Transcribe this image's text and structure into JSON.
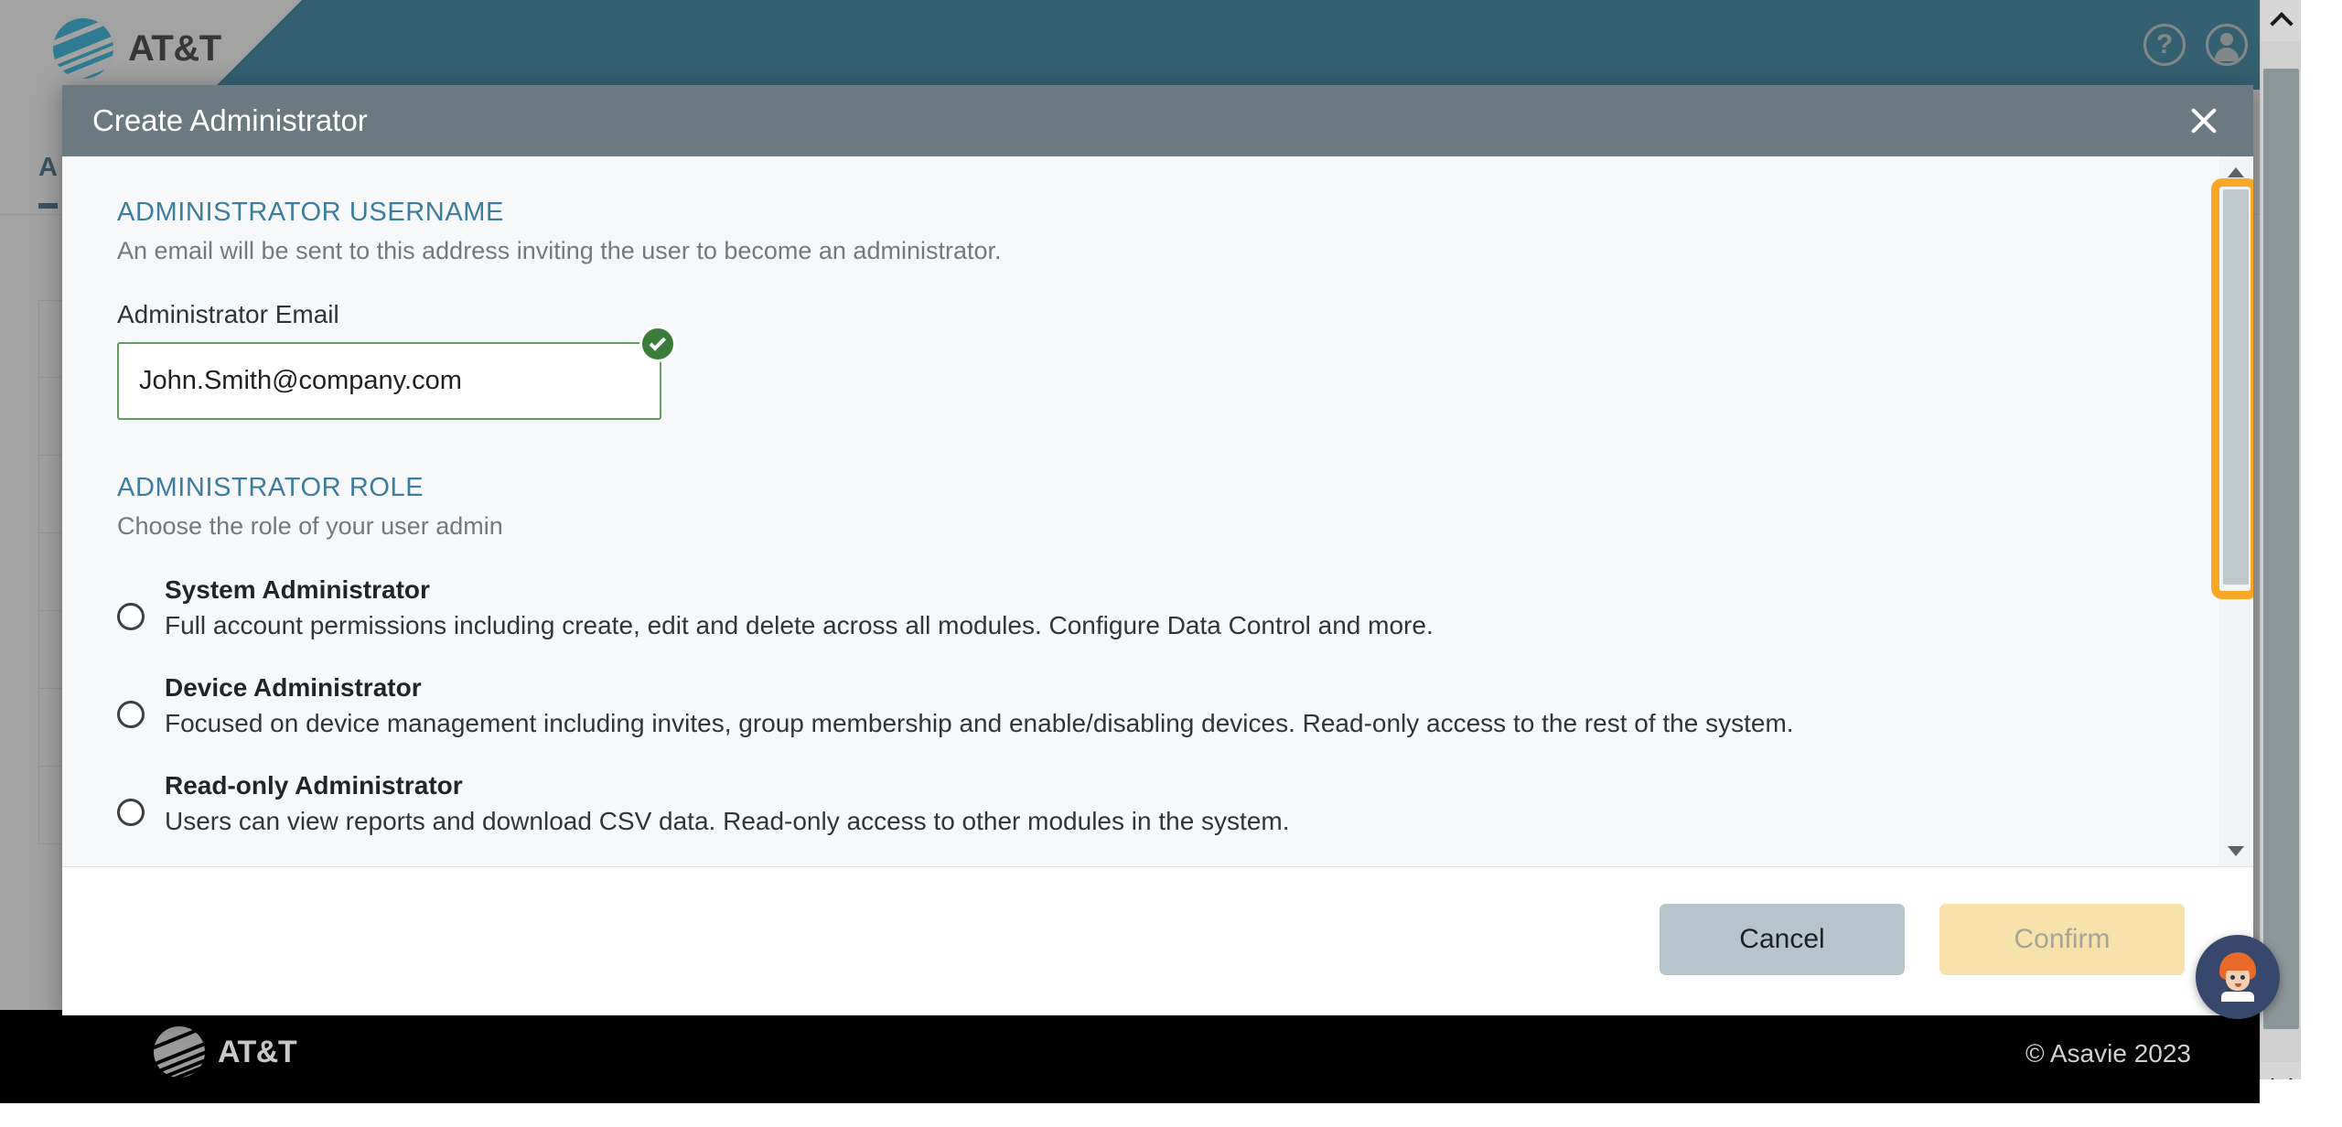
{
  "brand": {
    "name": "AT&T",
    "globe_icon": "att-globe-icon"
  },
  "topbar": {
    "help_icon": "help-icon",
    "help_glyph": "?",
    "account_icon": "account-icon"
  },
  "background_page": {
    "tab_label": "A",
    "rows_count": 7
  },
  "page_footer": {
    "logo_text": "AT&T",
    "copyright": "© Asavie 2023"
  },
  "modal": {
    "title": "Create Administrator",
    "close_icon": "close-icon",
    "username_section": {
      "heading": "ADMINISTRATOR USERNAME",
      "description": "An email will be sent to this address inviting the user to become an administrator.",
      "field_label": "Administrator Email",
      "email_value": "John.Smith@company.com",
      "email_placeholder": "Administrator Email",
      "valid_icon": "checkmark-valid-icon",
      "valid_color": "#3a7d3a"
    },
    "role_section": {
      "heading": "ADMINISTRATOR ROLE",
      "description": "Choose the role of your user admin",
      "options": [
        {
          "name": "System Administrator",
          "description": "Full account permissions including create, edit and delete across all modules. Configure Data Control and more.",
          "selected": false
        },
        {
          "name": "Device Administrator",
          "description": "Focused on device management including invites, group membership and enable/disabling devices. Read-only access to the rest of the system.",
          "selected": false
        },
        {
          "name": "Read-only Administrator",
          "description": "Users can view reports and download CSV data. Read-only access to other modules in the system.",
          "selected": false
        }
      ]
    },
    "footer": {
      "cancel_label": "Cancel",
      "confirm_label": "Confirm",
      "confirm_disabled": true
    },
    "scrollbar": {
      "up_icon": "scroll-up-arrow-icon",
      "down_icon": "scroll-down-arrow-icon",
      "highlight_color": "#f9a825"
    }
  },
  "page_scrollbar": {
    "up_icon": "page-scroll-up-icon",
    "down_icon": "page-scroll-down-icon"
  },
  "chat_widget": {
    "icon": "chat-avatar-icon",
    "accent_color": "#36486b"
  }
}
